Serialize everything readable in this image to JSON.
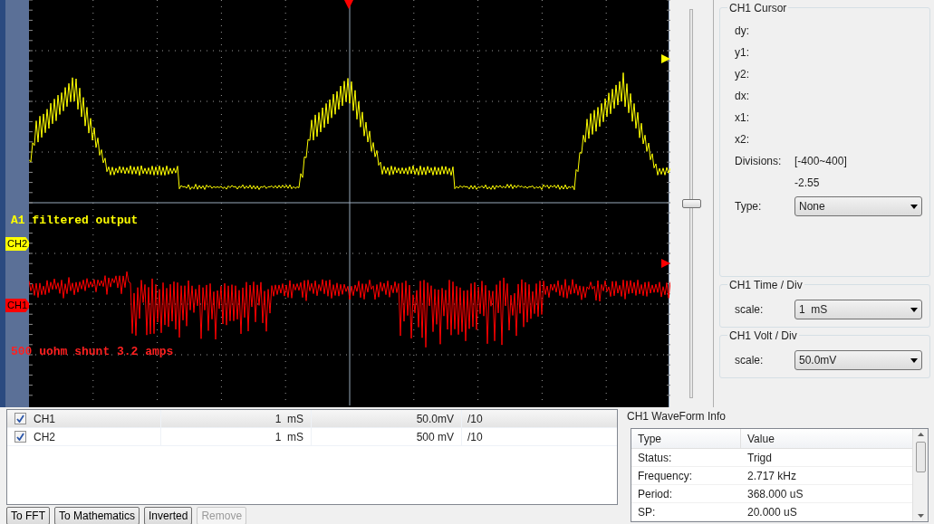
{
  "scope": {
    "annotations": [
      {
        "text": "A1 filtered output",
        "color": "#ffff00"
      },
      {
        "text": "500 uohm shunt 3.2 amps",
        "color": "#ff2020"
      }
    ],
    "markers": [
      {
        "label": "CH2",
        "color": "#ffff00"
      },
      {
        "label": "CH1",
        "color": "#ff0000"
      }
    ]
  },
  "offset_slider": {
    "level": 0.5
  },
  "cursor_panel": {
    "title": "CH1 Cursor",
    "fields": [
      {
        "label": "dy:"
      },
      {
        "label": "y1:"
      },
      {
        "label": "y2:"
      },
      {
        "label": "dx:"
      },
      {
        "label": "x1:"
      },
      {
        "label": "x2:"
      },
      {
        "label": "Divisions:",
        "value": "[-400~400]"
      }
    ],
    "reading": "-2.55",
    "type_label": "Type:",
    "type_value": "None"
  },
  "time_div": {
    "title": "CH1 Time / Div",
    "label": "scale:",
    "value": "1  mS"
  },
  "volt_div": {
    "title": "CH1 Volt / Div",
    "label": "scale:",
    "value": "50.0mV"
  },
  "channels": [
    {
      "name": "CH1",
      "checked": true,
      "selected": true,
      "time": "1  mS",
      "volt": "50.0mV",
      "probe": "/10"
    },
    {
      "name": "CH2",
      "checked": true,
      "selected": false,
      "time": "1  mS",
      "volt": "500 mV",
      "probe": "/10"
    }
  ],
  "buttons": [
    {
      "label": "To FFT",
      "disabled": false
    },
    {
      "label": "To Mathematics",
      "disabled": false
    },
    {
      "label": "Inverted",
      "disabled": false
    },
    {
      "label": "Remove",
      "disabled": true
    }
  ],
  "waveform_info": {
    "title": "CH1 WaveForm Info",
    "columns": [
      "Type",
      "Value"
    ],
    "rows": [
      [
        "Status:",
        "Trigd"
      ],
      [
        "Frequency:",
        "2.717 kHz"
      ],
      [
        "Period:",
        "368.000 uS"
      ],
      [
        "SP:",
        "20.000 uS"
      ]
    ]
  }
}
